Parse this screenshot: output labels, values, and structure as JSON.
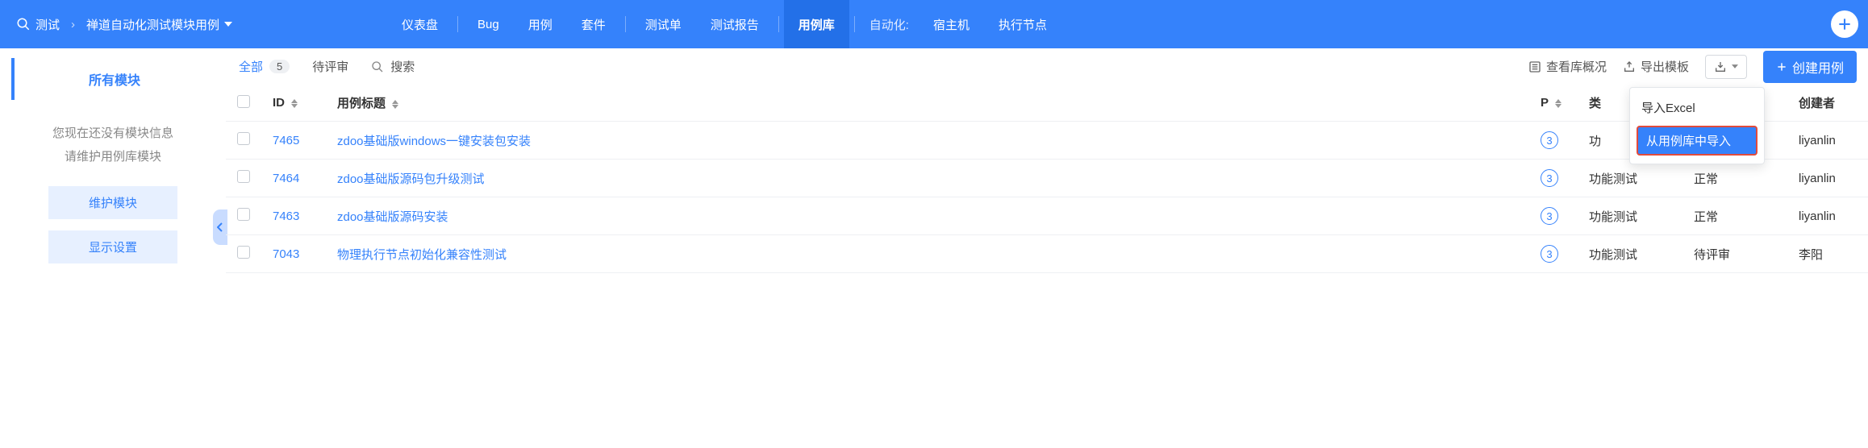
{
  "topbar": {
    "search_label": "测试",
    "breadcrumb": "禅道自动化测试模块用例",
    "nav": [
      {
        "label": "仪表盘"
      },
      {
        "label": "Bug"
      },
      {
        "label": "用例"
      },
      {
        "label": "套件"
      },
      {
        "label": "测试单"
      },
      {
        "label": "测试报告"
      },
      {
        "label": "用例库",
        "active": true
      }
    ],
    "automation_label": "自动化:",
    "automation_items": [
      {
        "label": "宿主机"
      },
      {
        "label": "执行节点"
      }
    ]
  },
  "sidebar": {
    "tab_label": "所有模块",
    "empty_line1": "您现在还没有模块信息",
    "empty_line2": "请维护用例库模块",
    "maintain_btn": "维护模块",
    "display_btn": "显示设置"
  },
  "toolbar": {
    "filter_all": "全部",
    "filter_all_count": "5",
    "filter_pending": "待评审",
    "filter_search": "搜索",
    "view_summary": "查看库概况",
    "export_template": "导出模板",
    "create_case": "创建用例"
  },
  "dropdown": {
    "import_excel": "导入Excel",
    "import_from_lib": "从用例库中导入"
  },
  "table": {
    "headers": {
      "id": "ID",
      "title": "用例标题",
      "p": "P",
      "type": "类",
      "status": "",
      "creator": "创建者"
    },
    "rows": [
      {
        "id": "7465",
        "title": "zdoo基础版windows一键安装包安装",
        "p": "3",
        "type": "功",
        "status": "",
        "creator": "liyanlin"
      },
      {
        "id": "7464",
        "title": "zdoo基础版源码包升级测试",
        "p": "3",
        "type": "功能测试",
        "status": "正常",
        "creator": "liyanlin"
      },
      {
        "id": "7463",
        "title": "zdoo基础版源码安装",
        "p": "3",
        "type": "功能测试",
        "status": "正常",
        "creator": "liyanlin"
      },
      {
        "id": "7043",
        "title": "物理执行节点初始化兼容性测试",
        "p": "3",
        "type": "功能测试",
        "status": "待评审",
        "creator": "李阳"
      }
    ]
  }
}
